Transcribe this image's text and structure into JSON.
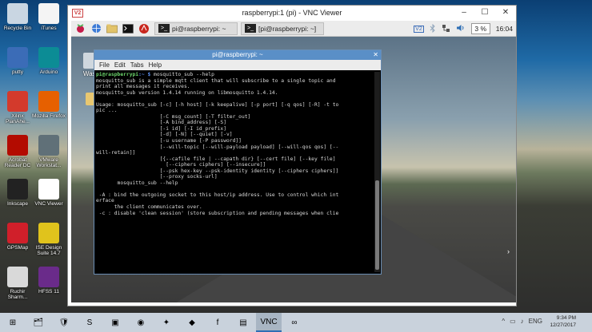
{
  "desktop_icons": [
    {
      "label": "Recycle Bin",
      "icon": "recycle-bin-icon",
      "color": "#c9d6e2"
    },
    {
      "label": "iTunes",
      "icon": "itunes-icon",
      "color": "#f4f4f4"
    },
    {
      "label": "putty",
      "icon": "putty-icon",
      "color": "#3b6cb7"
    },
    {
      "label": "Arduino",
      "icon": "arduino-icon",
      "color": "#0c8c95"
    },
    {
      "label": "Xilinx PlanAhe...",
      "icon": "xilinx-icon",
      "color": "#d33a2c"
    },
    {
      "label": "Mozilla Firefox",
      "icon": "firefox-icon",
      "color": "#e66000"
    },
    {
      "label": "Acrobat Reader DC",
      "icon": "acrobat-icon",
      "color": "#b30b00"
    },
    {
      "label": "VMware Workstat...",
      "icon": "vmware-icon",
      "color": "#607078"
    },
    {
      "label": "Inkscape",
      "icon": "inkscape-icon",
      "color": "#222222"
    },
    {
      "label": "VNC Viewer",
      "icon": "vnc-viewer-icon",
      "color": "#ffffff"
    },
    {
      "label": "GPSMap",
      "icon": "gpsmap-icon",
      "color": "#d01f2a"
    },
    {
      "label": "ISE Design Suite 14.7",
      "icon": "ise-icon",
      "color": "#e0c31c"
    },
    {
      "label": "Ruchir Sharm...",
      "icon": "folder-user-icon",
      "color": "#d9d9d9"
    },
    {
      "label": "HFSS 11",
      "icon": "hfss-icon",
      "color": "#6a2b8a"
    }
  ],
  "vnc_window": {
    "logo": "V2",
    "title": "raspberrypi:1 (pi) - VNC Viewer",
    "controls": [
      "–",
      "☐",
      "✕"
    ]
  },
  "pi_taskbar": {
    "tasks": [
      {
        "label": "pi@raspberrypi: ~",
        "icon": ">_"
      },
      {
        "label": "[pi@raspberrypi: ~]",
        "icon": ">_"
      }
    ],
    "tray": {
      "vnc": "V2",
      "cpu": "3 %",
      "time": "16:04"
    }
  },
  "pi_desktop": {
    "wastebasket": "Waste"
  },
  "terminal": {
    "title": "pi@raspberrypi: ~",
    "menu": [
      "File",
      "Edit",
      "Tabs",
      "Help"
    ],
    "prompt_user": "pi@raspberrypi",
    "prompt_dir": ":~ $",
    "command": " mosquitto_sub --help",
    "lines": [
      "mosquitto_sub is a simple mqtt client that will subscribe to a single topic and",
      "print all messages it receives.",
      "mosquitto_sub version 1.4.14 running on libmosquitto 1.4.14.",
      "",
      "Usage: mosquitto_sub [-c] [-h host] [-k keepalive] [-p port] [-q qos] [-R] -t to",
      "pic ...",
      "                     [-C msg_count] [-T filter_out]",
      "                     [-A bind_address] [-S]",
      "                     [-i id] [-I id_prefix]",
      "                     [-d] [-N] [--quiet] [-v]",
      "                     [-u username [-P password]]",
      "                     [--will-topic [--will-payload payload] [--will-qos qos] [--",
      "will-retain]]",
      "                     [{--cafile file | --capath dir} [--cert file] [--key file]",
      "                       [--ciphers ciphers] [--insecure]]",
      "                     [--psk hex-key --psk-identity identity [--ciphers ciphers]]",
      "                     [--proxy socks-url]",
      "       mosquitto_sub --help",
      "",
      " -A : bind the outgoing socket to this host/ip address. Use to control which int",
      "erface",
      "      the client communicates over.",
      " -c : disable 'clean session' (store subscription and pending messages when clie"
    ]
  },
  "win_taskbar": {
    "items": [
      "⊞",
      "🗂",
      "🛡",
      "S",
      "▣",
      "◉",
      "✦",
      "◆",
      "f",
      "▤",
      "VNC",
      "∞"
    ],
    "tray": [
      "^",
      "▭",
      "♪",
      "ENG"
    ],
    "time": "9:34 PM",
    "date": "12/27/2017"
  }
}
